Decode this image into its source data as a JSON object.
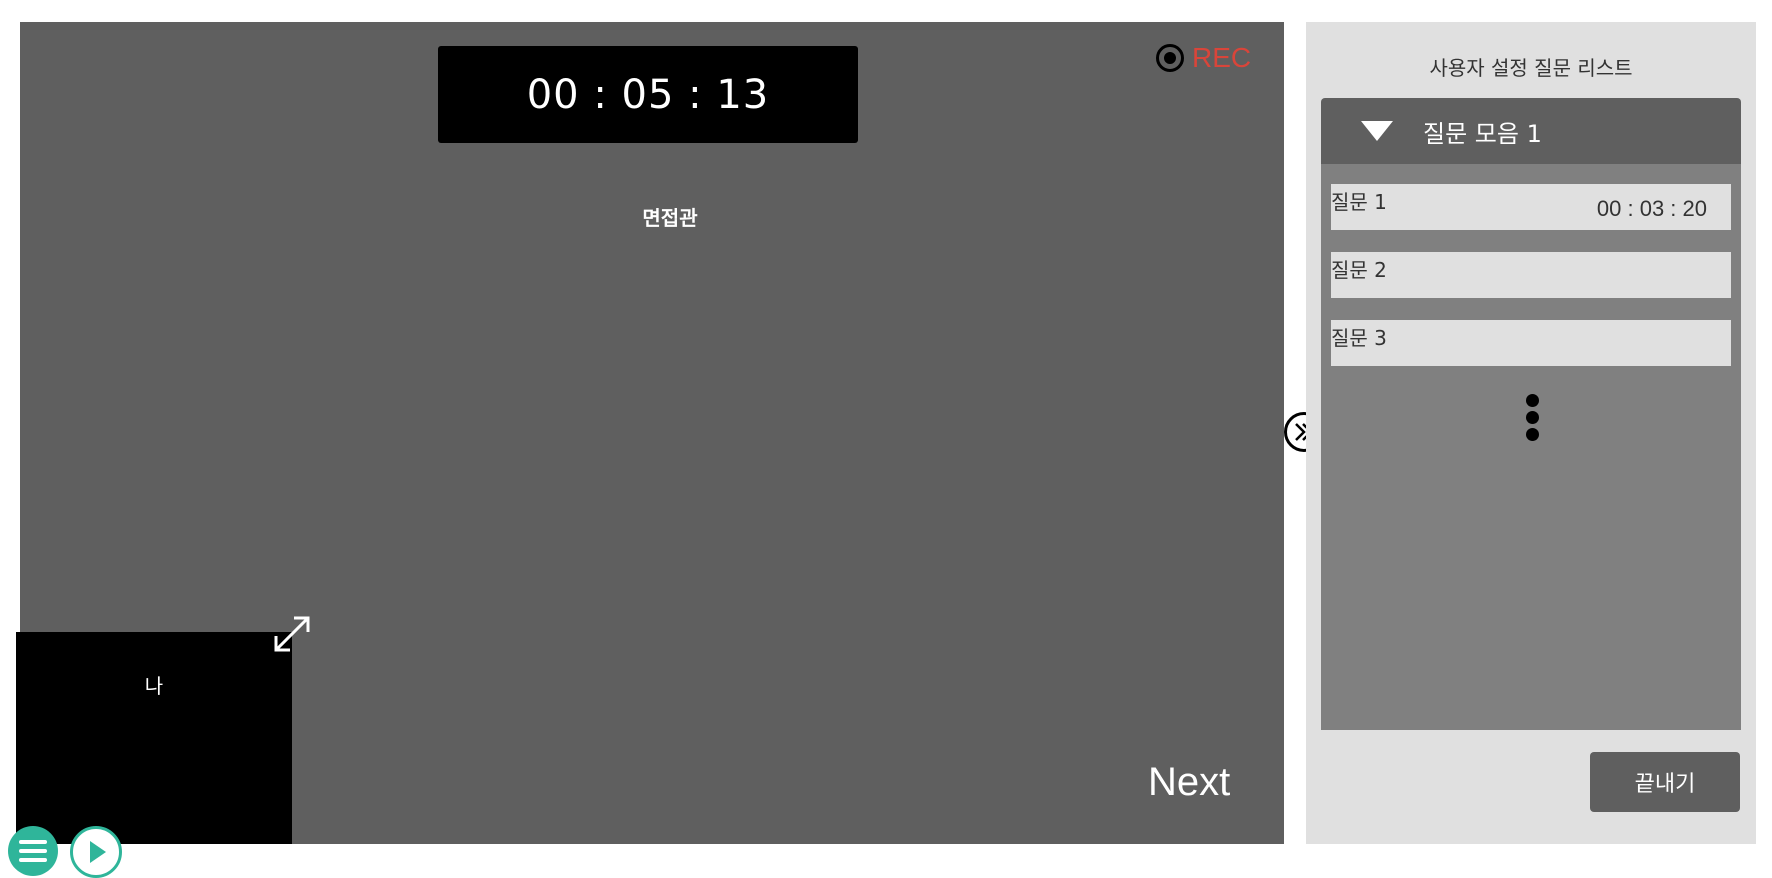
{
  "stage": {
    "timer": "00 : 05 : 13",
    "rec_label": "REC",
    "interviewer_label": "면접관",
    "self_label": "나",
    "next_label": "Next"
  },
  "panel": {
    "title": "사용자 설정 질문 리스트",
    "group": {
      "label": "질문 모음 1",
      "questions": [
        {
          "label": "질문 1",
          "time": "00 : 03 : 20"
        },
        {
          "label": "질문 2",
          "time": ""
        },
        {
          "label": "질문 3",
          "time": ""
        }
      ]
    },
    "end_label": "끝내기"
  },
  "icons": {
    "rec": "record-icon",
    "expand": "expand-icon",
    "collapse": "double-chevron-right-icon",
    "group_toggle": "triangle-down-icon",
    "more": "more-vertical-icon",
    "menu": "menu-icon",
    "play": "play-icon"
  },
  "colors": {
    "stage_bg": "#5f5f5f",
    "panel_bg": "#e0e0e0",
    "rec_red": "#d9453a",
    "accent_teal": "#2fb59a"
  }
}
